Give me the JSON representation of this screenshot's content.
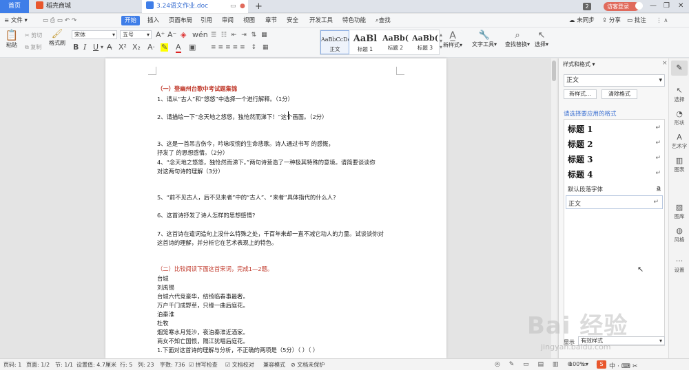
{
  "titlebar": {
    "home_tab": "首页",
    "store_tab": "稻壳商城",
    "doc_tab": "3.24语文作业.doc",
    "window_count": "2",
    "login": "访客登录"
  },
  "menubar": {
    "file": "文件",
    "items": [
      "开始",
      "插入",
      "页面布局",
      "引用",
      "审阅",
      "视图",
      "章节",
      "安全",
      "开发工具",
      "特色功能"
    ],
    "search": "查找",
    "right": [
      "未同步",
      "分享",
      "批注"
    ]
  },
  "toolbar": {
    "paste": "粘贴",
    "cut": "剪切",
    "copy": "复制",
    "format_painter": "格式刷",
    "font_name": "宋体",
    "font_size": "五号",
    "styles": [
      {
        "preview": "AaBbCcDd",
        "label": "正文"
      },
      {
        "preview": "AaBl",
        "label": "标题 1"
      },
      {
        "preview": "AaBb(",
        "label": "标题 2"
      },
      {
        "preview": "AaBb(",
        "label": "标题 3"
      }
    ],
    "new_style": "新样式",
    "text_tools": "文字工具",
    "find_replace": "查找替换",
    "select": "选择"
  },
  "document": {
    "lines": [
      {
        "text": "（一）登幽州台歌中考试题集锦",
        "style": "red bold"
      },
      {
        "text": "1、请从“古人”和“悠悠”中选择一个进行解释。（1分）",
        "style": ""
      },
      {
        "text": "2、请描绘一下“念天地之悠悠，独怆然而涕下！”这个画面。（2分）",
        "style": ""
      },
      {
        "text": "3、这是一首吊古伤今，吟咏叹惋的生命悲歌。诗人通过书写                  的感慨，",
        "style": ""
      },
      {
        "text": "抒发了                          的思想感情。（2分）",
        "style": ""
      },
      {
        "text": "4、“念天地之悠悠，独怆然而涕下。”两句诗营造了一种极其特殊的意境。请简要谈谈你",
        "style": ""
      },
      {
        "text": "对这两句诗的理解（3分）",
        "style": ""
      },
      {
        "text": "5、“前不见古人，后不见来者”中的“古人”、“来者”具体指代的什么人?",
        "style": ""
      },
      {
        "text": "6、这首诗抒发了诗人怎样的思想感情?",
        "style": ""
      },
      {
        "text": "7、这首诗在遣词造句上没什么特殊之处，千百年来却一直不减它动人的力量。试谈谈你对",
        "style": ""
      },
      {
        "text": "这首诗的理解，并分析它在艺术表现上的特色。",
        "style": ""
      },
      {
        "text": "（二）比较阅读下面这首宋词，完成1—2题。",
        "style": "red"
      },
      {
        "text": "台城",
        "style": ""
      },
      {
        "text": "刘禹锡",
        "style": ""
      },
      {
        "text": "台城六代竞豪华，结绮临春事最奢。",
        "style": ""
      },
      {
        "text": "万户千门成野草，只缘一曲后庭花。",
        "style": ""
      },
      {
        "text": "泊秦淮",
        "style": ""
      },
      {
        "text": "杜牧",
        "style": ""
      },
      {
        "text": "烟笼寒水月笼沙，夜泊秦淮近酒家。",
        "style": ""
      },
      {
        "text": "商女不知亡国恨，隔江犹唱后庭花。",
        "style": ""
      },
      {
        "text": "1.下面对这首诗的理解与分析，不正确的两项是（5分）（        ）（        ）",
        "style": ""
      }
    ]
  },
  "panel": {
    "title": "样式和格式",
    "current": "正文",
    "new_style": "新样式...",
    "clear_format": "清除格式",
    "prompt": "请选择要应用的格式",
    "items": [
      "标题 1",
      "标题 2",
      "标题 3",
      "标题 4"
    ],
    "default_font": "默认段落字体",
    "body": "正文",
    "show_label": "显示",
    "show_value": "有效样式"
  },
  "sidebar": [
    "选择",
    "形状",
    "艺术字",
    "图表",
    "图库",
    "风格",
    "设置"
  ],
  "statusbar": {
    "page_no": "页码: 1",
    "pages": "页面: 1/2",
    "section": "节: 1/1",
    "setting": "设置值: 4.7厘米",
    "row": "行: 5",
    "col": "列: 23",
    "words": "字数: 736",
    "spell": "拼写检查",
    "proof": "文档校对",
    "compat": "兼容模式",
    "unprotected": "文档未保护",
    "zoom": "100%"
  },
  "watermark": {
    "brand": "Bai 经验",
    "url": "jingyan.baidu.com"
  }
}
